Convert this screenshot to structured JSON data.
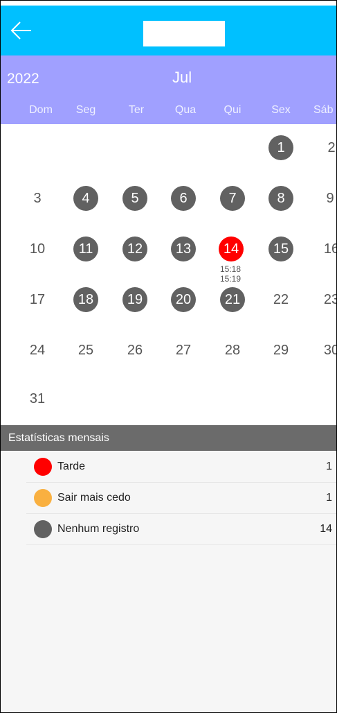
{
  "header": {
    "back_icon": "arrow-left-icon",
    "title_box_color": "#ffffff",
    "bar_color": "#00c0ff"
  },
  "calendar_header": {
    "year": "2022",
    "month": "Jul",
    "weekdays": [
      "Dom",
      "Seg",
      "Ter",
      "Qua",
      "Qui",
      "Sex",
      "Sáb"
    ],
    "bar_color": "#a0a0ff"
  },
  "calendar": {
    "days": [
      "1",
      "2",
      "3",
      "4",
      "5",
      "6",
      "7",
      "8",
      "9",
      "10",
      "11",
      "12",
      "13",
      "14",
      "15",
      "16",
      "17",
      "18",
      "19",
      "20",
      "21",
      "22",
      "23",
      "24",
      "25",
      "26",
      "27",
      "28",
      "29",
      "30",
      "31"
    ],
    "today": "14",
    "today_times": [
      "15:18",
      "15:19"
    ],
    "record_color": "#616161",
    "today_color": "#ff0000"
  },
  "stats": {
    "title": "Estatísticas mensais",
    "items": [
      {
        "label": "Tarde",
        "count": "1",
        "color": "#ff0000"
      },
      {
        "label": "Sair mais cedo",
        "count": "1",
        "color": "#f9b040"
      },
      {
        "label": "Nenhum registro",
        "count": "14",
        "color": "#616161"
      }
    ]
  }
}
